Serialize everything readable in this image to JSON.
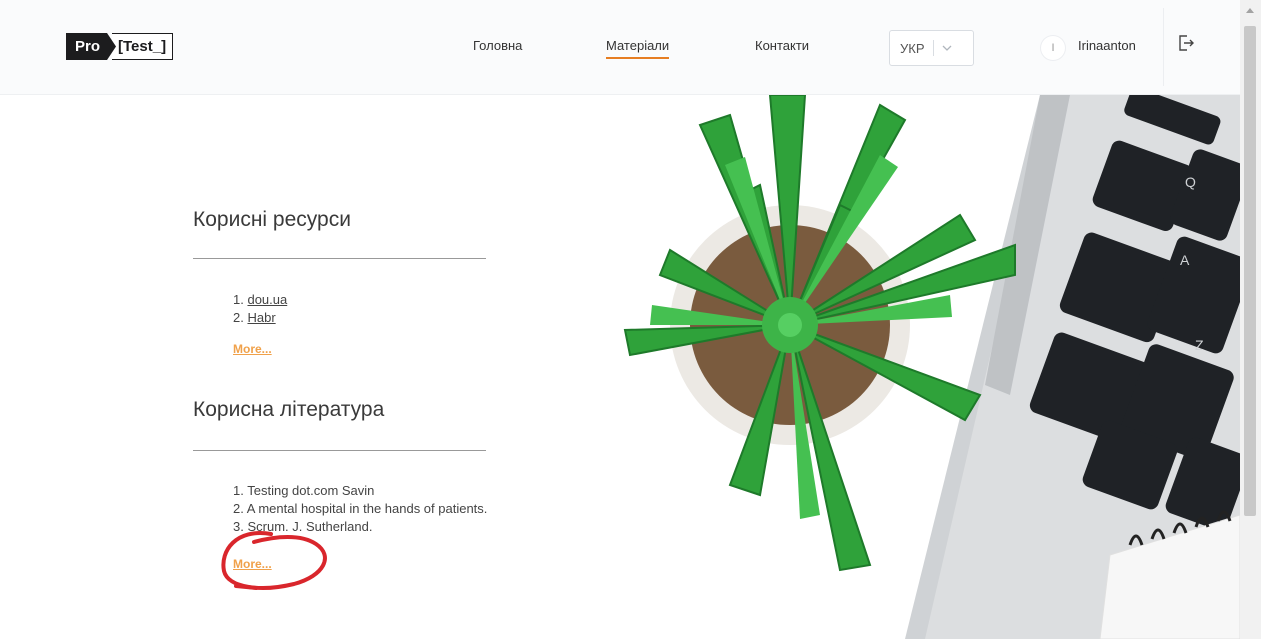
{
  "header": {
    "logo_pro": "Pro",
    "logo_test": "[Test_]",
    "nav": [
      {
        "label": "Головна",
        "active": false
      },
      {
        "label": "Матеріали",
        "active": true
      },
      {
        "label": "Контакти",
        "active": false
      }
    ],
    "lang": {
      "selected": "УКР"
    },
    "user": {
      "initial": "I",
      "name": "Irinaanton"
    },
    "accent_color": "#e67e22"
  },
  "resources": {
    "title": "Корисні ресурси",
    "items": [
      {
        "num": "1.",
        "label": "dou.ua"
      },
      {
        "num": "2.",
        "label": "Habr"
      }
    ],
    "more": "More..."
  },
  "literature": {
    "title": "Корисна література",
    "items": [
      {
        "num": "1.",
        "label": "Testing dot.com Savin"
      },
      {
        "num": "2.",
        "label": "A mental hospital in the hands of patients."
      },
      {
        "num": "3.",
        "label": "Scrum. J. Sutherland."
      }
    ],
    "more": "More..."
  },
  "icons": {
    "logout": "logout-icon",
    "lang_chevron": "chevron-down-icon"
  },
  "colors": {
    "more_link": "#f0a14a",
    "annotation": "#d9262c"
  }
}
